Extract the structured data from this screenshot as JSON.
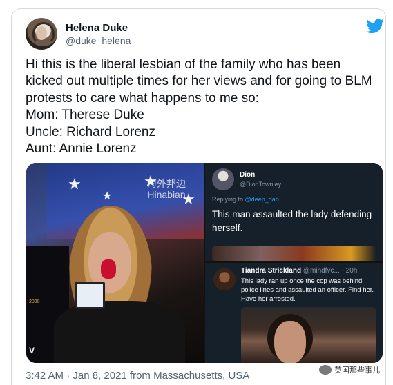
{
  "author": {
    "name": "Helena Duke",
    "handle": "@duke_helena"
  },
  "tweet": {
    "lines": [
      "Hi this is the liberal lesbian of the family who has been",
      "kicked out multiple times for her views and for going to BLM",
      "protests to care what happens to me so:",
      "Mom: Therese Duke",
      "Uncle: Richard Lorenz",
      "Aunt: Annie Lorenz"
    ]
  },
  "media": {
    "photo_watermark_line1": "海外邦边",
    "photo_watermark_line2": "Hinabian",
    "photo_badge": "2020",
    "photo_corner_letter": "V",
    "reply_card": {
      "name": "Dion",
      "handle": "@DionTownley",
      "replying_prefix": "Replying to",
      "replying_handle": "@deep_dab",
      "text": "This man assaulted the lady defending herself."
    },
    "quote_card": {
      "name": "Tiandra Strickland",
      "meta": "@mindfvc... · 20h",
      "text": "This lady ran up once the cop was behind police lines and assaulted an officer. Find her. Have her arrested."
    }
  },
  "footer": {
    "timestamp": "3:42 AM · Jan 8, 2021 from Massachusetts, USA"
  },
  "watermark": {
    "text": "英国那些事儿"
  },
  "colors": {
    "twitter_blue": "#1da1f2",
    "dark_card": "#15202b",
    "text": "#0f1419",
    "muted": "#536471"
  },
  "icons": {
    "brand": "twitter-bird-icon"
  }
}
